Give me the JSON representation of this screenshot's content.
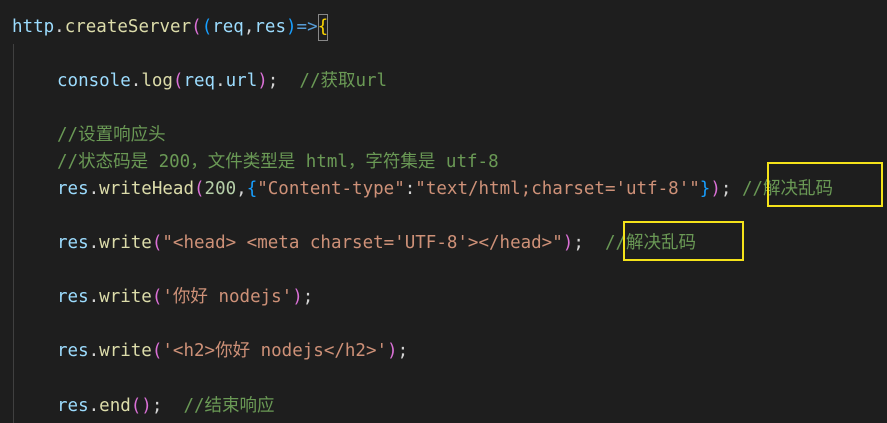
{
  "code": {
    "line1": {
      "obj": "http",
      "dot": ".",
      "fn": "createServer",
      "open1": "(",
      "open2": "(",
      "arg1": "req",
      "comma": ",",
      "arg2": "res",
      "close2": ")",
      "arrow": "=>",
      "brace": "{"
    },
    "line2": {
      "obj": "console",
      "dot": ".",
      "fn": "log",
      "open": "(",
      "arg": "req",
      "dot2": ".",
      "prop": "url",
      "close": ")",
      "semi": ";",
      "comment": "//获取url"
    },
    "line3": {
      "comment": "//设置响应头"
    },
    "line4": {
      "comment": "//状态码是 200，文件类型是 html，字符集是 utf-8"
    },
    "line5": {
      "obj": "res",
      "dot": ".",
      "fn": "writeHead",
      "open": "(",
      "num": "200",
      "comma": ",",
      "brace_open": "{",
      "key": "\"Content-type\"",
      "colon": ":",
      "val": "\"text/html;charset='utf-8'\"",
      "brace_close": "}",
      "close": ")",
      "semi": ";",
      "comment": "//解决乱码"
    },
    "line6": {
      "obj": "res",
      "dot": ".",
      "fn": "write",
      "open": "(",
      "str": "\"<head> <meta charset='UTF-8'></head>\"",
      "close": ")",
      "semi": ";",
      "comment": "//解决乱码"
    },
    "line7": {
      "obj": "res",
      "dot": ".",
      "fn": "write",
      "open": "(",
      "str": "'你好 nodejs'",
      "close": ")",
      "semi": ";"
    },
    "line8": {
      "obj": "res",
      "dot": ".",
      "fn": "write",
      "open": "(",
      "str": "'<h2>你好 nodejs</h2>'",
      "close": ")",
      "semi": ";"
    },
    "line9": {
      "obj": "res",
      "dot": ".",
      "fn": "end",
      "parens": "()",
      "semi": ";",
      "comment": "//结束响应"
    }
  },
  "colors": {
    "background": "#1e1e1e",
    "highlight_box": "#f4e21a",
    "comment": "#6a9955",
    "string": "#ce9178",
    "function": "#dcdcaa",
    "variable": "#9cdcfe"
  }
}
